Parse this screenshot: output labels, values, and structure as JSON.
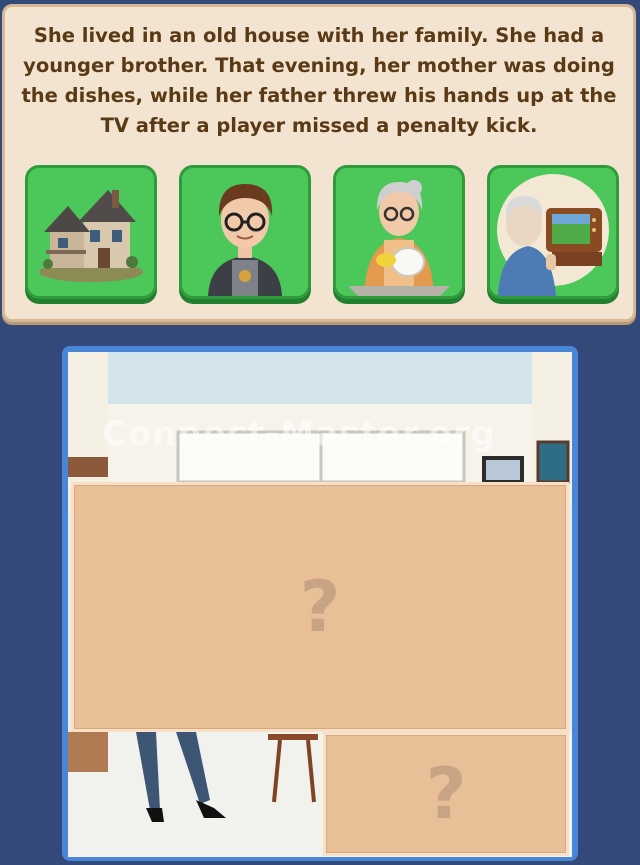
{
  "story": {
    "text": "She lived in an old house with her family. She had a younger brother. That evening, her mother was doing the dishes, while her father threw his hands up at the TV after a player missed a penalty kick."
  },
  "clue_tiles": [
    {
      "icon": "old-house-icon"
    },
    {
      "icon": "younger-brother-icon"
    },
    {
      "icon": "mother-doing-dishes-icon"
    },
    {
      "icon": "father-watching-tv-icon"
    }
  ],
  "board": {
    "watermark": "Connect-Master.org",
    "hidden_panels": [
      {
        "symbol": "?"
      },
      {
        "symbol": "?"
      }
    ]
  },
  "colors": {
    "background": "#33497a",
    "story_card": "#f3e4d2",
    "story_text": "#5a3a14",
    "tile_green": "#4cc75a",
    "board_border": "#4a86d8",
    "hidden_panel": "#e9bf97"
  }
}
